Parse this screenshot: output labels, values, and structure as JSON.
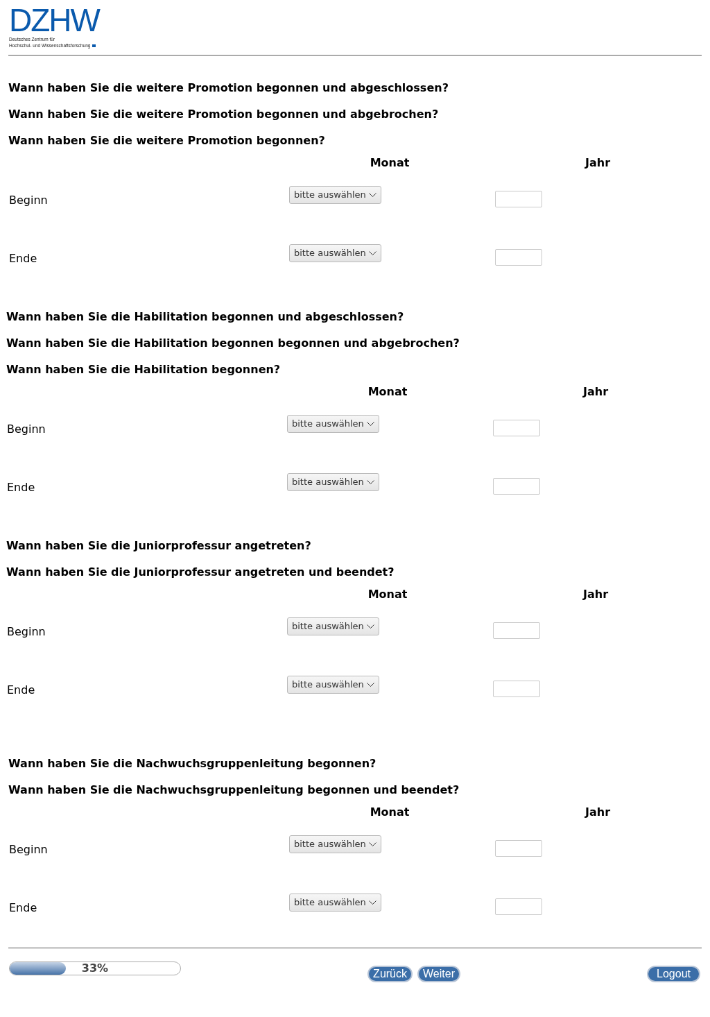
{
  "logo": {
    "wordmark": "DZHW",
    "tagline": [
      "Deutsches Zentrum für",
      "Hochschul- und Wissenschaftsforschung"
    ]
  },
  "sections": [
    {
      "questions": [
        "Wann haben Sie die weitere Promotion begonnen und abgeschlossen?",
        "Wann haben Sie die weitere Promotion begonnen und abgebrochen?",
        "Wann haben Sie die weitere Promotion begonnen?"
      ],
      "columns": [
        "Monat",
        "Jahr"
      ],
      "rows": [
        {
          "label": "Beginn",
          "month": "bitte auswählen"
        },
        {
          "label": "Ende",
          "month": "bitte auswählen"
        }
      ]
    },
    {
      "questions": [
        "Wann haben Sie die Habilitation begonnen und abgeschlossen?",
        "Wann haben Sie die Habilitation begonnen begonnen und abgebrochen?",
        "Wann haben Sie die Habilitation begonnen?"
      ],
      "columns": [
        "Monat",
        "Jahr"
      ],
      "rows": [
        {
          "label": "Beginn",
          "month": "bitte auswählen"
        },
        {
          "label": "Ende",
          "month": "bitte auswählen"
        }
      ]
    },
    {
      "questions": [
        "Wann haben Sie die Juniorprofessur angetreten?",
        "Wann haben Sie die Juniorprofessur angetreten und beendet?"
      ],
      "columns": [
        "Monat",
        "Jahr"
      ],
      "rows": [
        {
          "label": "Beginn",
          "month": "bitte auswählen"
        },
        {
          "label": "Ende",
          "month": "bitte auswählen"
        }
      ]
    },
    {
      "questions": [
        "Wann haben Sie die Nachwuchsgruppenleitung begonnen?",
        "Wann haben Sie die Nachwuchsgruppenleitung begonnen und beendet?"
      ],
      "columns": [
        "Monat",
        "Jahr"
      ],
      "rows": [
        {
          "label": "Beginn",
          "month": "bitte auswählen"
        },
        {
          "label": "Ende",
          "month": "bitte auswählen"
        }
      ]
    }
  ],
  "progress": {
    "level": 0.33,
    "reading": "33%"
  },
  "nav_buttons": [
    "Zurück",
    "Weiter"
  ],
  "logout_button": "Logout"
}
